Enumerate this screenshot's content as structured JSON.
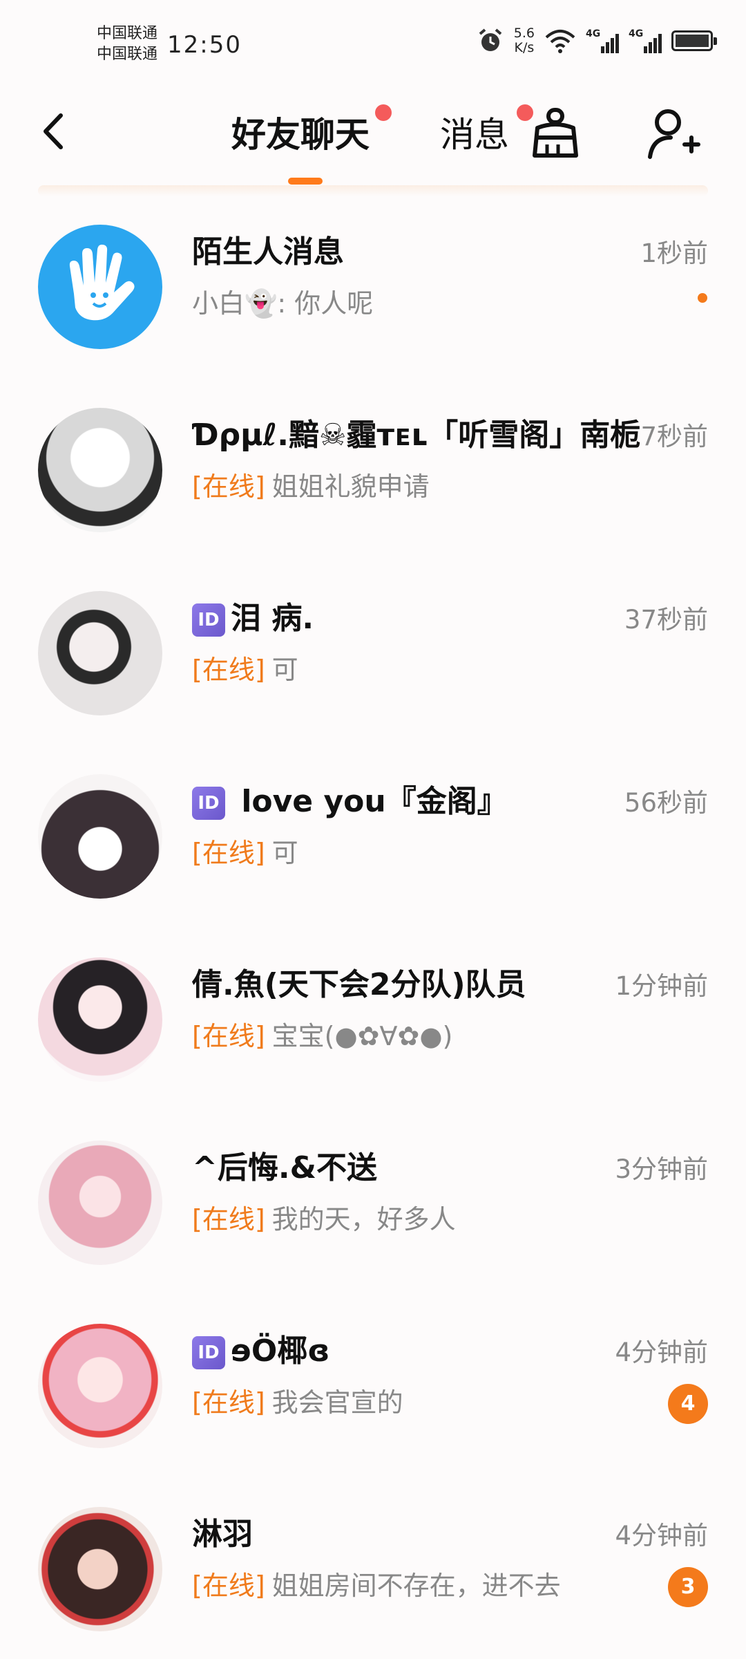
{
  "status_bar": {
    "carrier_1": "中国联通",
    "carrier_2": "中国联通",
    "time": "12:50",
    "speed_value": "5.6",
    "speed_unit": "K/s",
    "network_1": "4G",
    "network_2": "4G"
  },
  "header": {
    "tab_friends": "好友聊天",
    "tab_messages": "消息"
  },
  "chats": [
    {
      "name": "陌生人消息",
      "time": "1秒前",
      "preview_prefix": "",
      "preview": "小白👻: 你人呢",
      "has_id_tag": false,
      "unread": "",
      "dot": true
    },
    {
      "name": "Ɗρµℓ.黯☠霾ᴛᴇʟ「听雪阁」南栀",
      "time": "7秒前",
      "preview_prefix": "[在线]",
      "preview": "姐姐礼貌申请",
      "has_id_tag": false,
      "unread": "",
      "dot": false
    },
    {
      "name": "泪  病.",
      "time": "37秒前",
      "preview_prefix": "[在线]",
      "preview": "可",
      "has_id_tag": true,
      "unread": "",
      "dot": false
    },
    {
      "name": " love you『金阁』",
      "time": "56秒前",
      "preview_prefix": "[在线]",
      "preview": "可",
      "has_id_tag": true,
      "unread": "",
      "dot": false
    },
    {
      "name": "倩.魚(天下会2分队)队员",
      "time": "1分钟前",
      "preview_prefix": "[在线]",
      "preview": "宝宝(●✿∀✿●)",
      "has_id_tag": false,
      "unread": "",
      "dot": false
    },
    {
      "name": "^后悔.&不送",
      "time": "3分钟前",
      "preview_prefix": "[在线]",
      "preview": "我的天，好多人",
      "has_id_tag": false,
      "unread": "",
      "dot": false
    },
    {
      "name": "ɘÖ椰ɞ",
      "time": "4分钟前",
      "preview_prefix": "[在线]",
      "preview": "我会官宣的",
      "has_id_tag": true,
      "unread": "4",
      "dot": false
    },
    {
      "name": "淋羽",
      "time": "4分钟前",
      "preview_prefix": "[在线]",
      "preview": "姐姐房间不存在，进不去",
      "has_id_tag": false,
      "unread": "3",
      "dot": false
    }
  ],
  "id_tag_label": "ID",
  "icons": [
    "back-icon",
    "broom-icon",
    "add-friend-icon",
    "alarm-icon",
    "wifi-icon",
    "signal-icon",
    "battery-icon"
  ]
}
